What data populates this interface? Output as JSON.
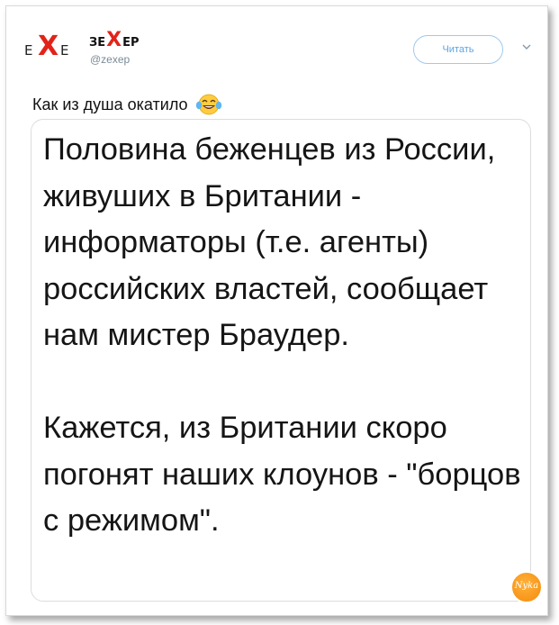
{
  "tweet": {
    "avatar": {
      "left": "E",
      "x": "X",
      "right": "E"
    },
    "author": {
      "name_a": "ЗЕ",
      "name_x": "X",
      "name_b": "ЕР",
      "handle": "@zexep"
    },
    "follow_label": "Читать",
    "caret_icon": "chevron-down-icon",
    "text": "Как из душа окатило",
    "emoji": "face-with-tears-of-joy",
    "image_text": "Половина беженцев из России, живуших в Британии - информаторы (т.е. агенты) российских властей, сообщает нам мистер Браудер.\n\nКажется, из Британии скоро погонят наших клоунов - \"борцов с режимом\"."
  },
  "watermark": {
    "text": "Nyka"
  },
  "colors": {
    "accent": "#5aa5e5",
    "brand_red": "#e2231a",
    "watermark_orange": "#f58a0b"
  }
}
